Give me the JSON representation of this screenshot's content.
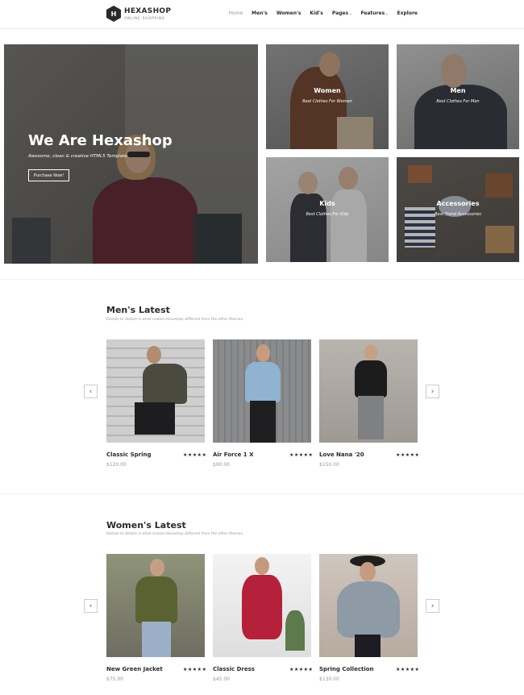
{
  "brand": {
    "logo_letter": "H",
    "name": "HEXASHOP",
    "tagline": "ONLINE SHOPPING"
  },
  "nav": [
    {
      "label": "Home"
    },
    {
      "label": "Men's"
    },
    {
      "label": "Women's"
    },
    {
      "label": "Kid's"
    },
    {
      "label": "Pages"
    },
    {
      "label": "Features"
    },
    {
      "label": "Explore"
    }
  ],
  "hero": {
    "title": "We Are Hexashop",
    "subtitle": "Awesome, clean & creative HTML5 Template",
    "button": "Purchase Now!"
  },
  "tiles": [
    {
      "title": "Women",
      "subtitle": "Best Clothes For Women"
    },
    {
      "title": "Men",
      "subtitle": "Best Clothes For Men"
    },
    {
      "title": "Kids",
      "subtitle": "Best Clothes For Kids"
    },
    {
      "title": "Accessories",
      "subtitle": "Best Trend Accessories"
    }
  ],
  "mens": {
    "title": "Men's Latest",
    "subtitle": "Details to details is what makes Hexashop different from the other themes.",
    "products": [
      {
        "name": "Classic Spring",
        "price": "$120.00",
        "stars": "★★★★★"
      },
      {
        "name": "Air Force 1 X",
        "price": "$90.00",
        "stars": "★★★★★"
      },
      {
        "name": "Love Nana '20",
        "price": "$150.00",
        "stars": "★★★★★"
      }
    ]
  },
  "womens": {
    "title": "Women's Latest",
    "subtitle": "Details to details is what makes Hexashop different from the other themes.",
    "products": [
      {
        "name": "New Green Jacket",
        "price": "$75.00",
        "stars": "★★★★★"
      },
      {
        "name": "Classic Dress",
        "price": "$45.00",
        "stars": "★★★★★"
      },
      {
        "name": "Spring Collection",
        "price": "$130.00",
        "stars": "★★★★★"
      }
    ]
  },
  "arrows": {
    "prev": "‹",
    "next": "›"
  }
}
